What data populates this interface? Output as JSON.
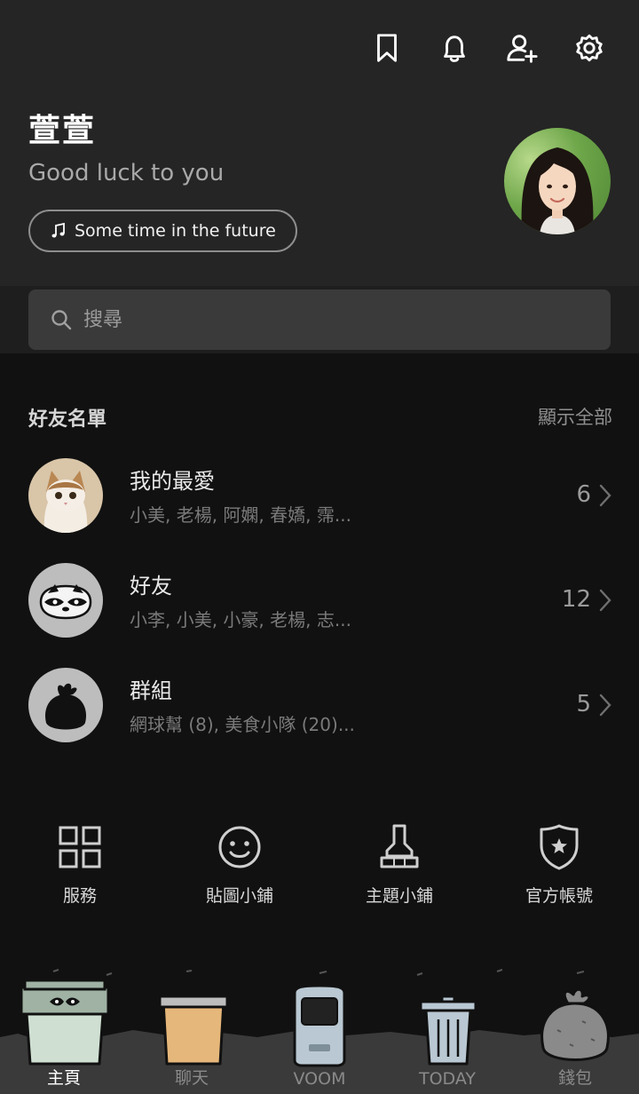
{
  "profile": {
    "name": "萱萱",
    "status": "Good luck to you",
    "music": "Some time in the future"
  },
  "top_icons": [
    "bookmark-icon",
    "bell-icon",
    "add-friend-icon",
    "settings-icon"
  ],
  "search": {
    "placeholder": "搜尋"
  },
  "friends_section": {
    "title": "好友名單",
    "show_all": "顯示全部",
    "rows": [
      {
        "title": "我的最愛",
        "subtitle": "小美, 老楊, 阿嫻, 春嬌, 霈...",
        "count": "6"
      },
      {
        "title": "好友",
        "subtitle": "小李, 小美, 小豪, 老楊, 志...",
        "count": "12"
      },
      {
        "title": "群組",
        "subtitle": "網球幫 (8), 美食小隊 (20)...",
        "count": "5"
      }
    ]
  },
  "services": [
    {
      "label": "服務",
      "icon": "grid-icon"
    },
    {
      "label": "貼圖小鋪",
      "icon": "smiley-icon"
    },
    {
      "label": "主題小鋪",
      "icon": "brush-icon"
    },
    {
      "label": "官方帳號",
      "icon": "shield-star-icon"
    }
  ],
  "bottom_nav": [
    {
      "label": "主頁",
      "icon": "raccoon-bin-icon",
      "active": true
    },
    {
      "label": "聊天",
      "icon": "paper-bin-icon",
      "active": false
    },
    {
      "label": "VOOM",
      "icon": "robot-bin-icon",
      "active": false
    },
    {
      "label": "TODAY",
      "icon": "trash-can-icon",
      "active": false
    },
    {
      "label": "錢包",
      "icon": "garbage-bag-icon",
      "active": false
    }
  ],
  "colors": {
    "header_bg": "#252525",
    "body_bg": "#111111",
    "search_bg": "#3a3a3a",
    "muted_text": "#7a7a7a"
  }
}
